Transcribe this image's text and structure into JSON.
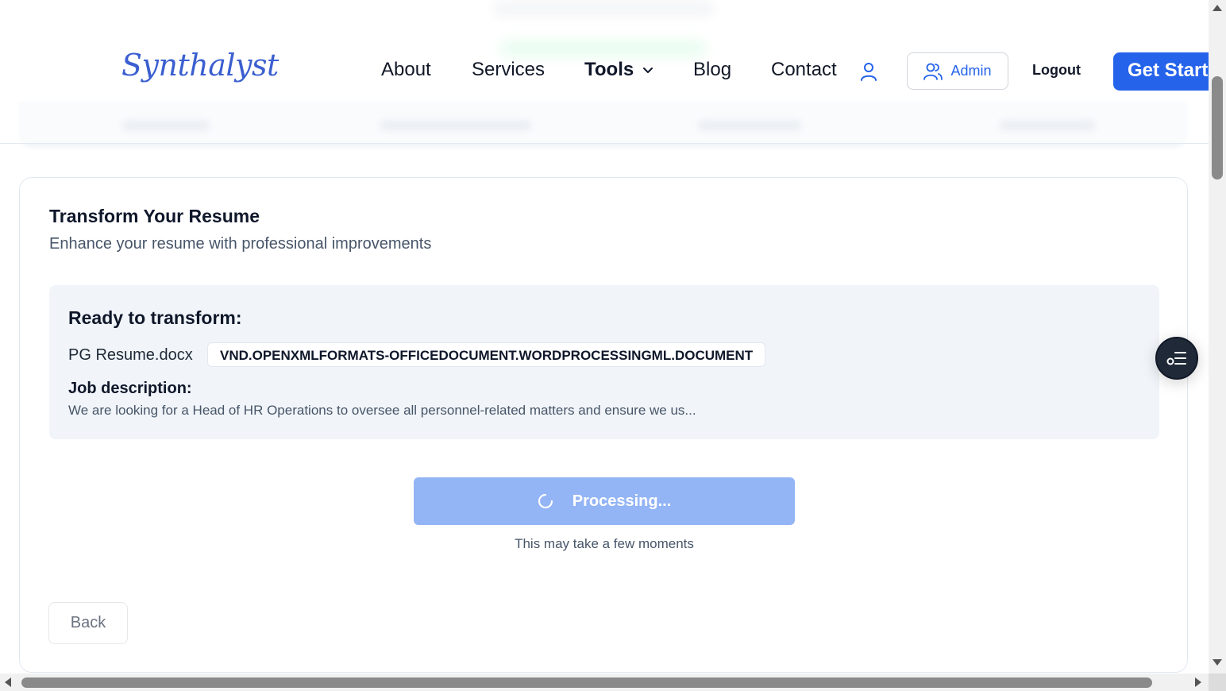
{
  "header": {
    "logo": "Synthalyst",
    "nav": {
      "about": "About",
      "services": "Services",
      "tools": "Tools",
      "blog": "Blog",
      "contact": "Contact"
    },
    "admin_label": "Admin",
    "logout_label": "Logout",
    "cta_label": "Get Started"
  },
  "card": {
    "title": "Transform Your Resume",
    "subtitle": "Enhance your resume with professional improvements",
    "summary": {
      "heading": "Ready to transform:",
      "file_name": "PG Resume.docx",
      "file_type": "VND.OPENXMLFORMATS-OFFICEDOCUMENT.WORDPROCESSINGML.DOCUMENT",
      "job_label": "Job description:",
      "job_text": "We are looking for a Head of HR Operations to oversee all personnel-related matters and ensure we us..."
    },
    "process_label": "Processing...",
    "hint": "This may take a few moments",
    "back_label": "Back"
  },
  "icons": {
    "user": "user-icon",
    "admin": "users-icon",
    "chevron": "chevron-down-icon",
    "spinner": "spinner-icon",
    "float": "list-checks-icon"
  },
  "colors": {
    "primary": "#2563eb",
    "processing_button": "#93b4f5",
    "summary_bg": "#f1f5f9"
  }
}
